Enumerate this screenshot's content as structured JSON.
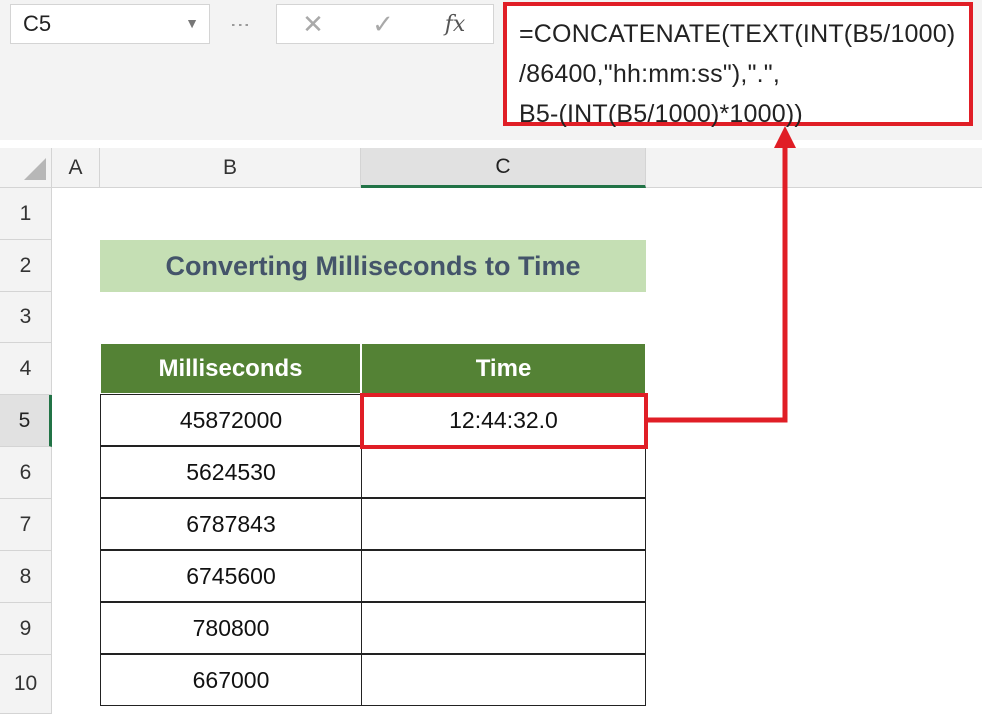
{
  "formula_bar": {
    "name_box": "C5",
    "cancel_icon": "x-icon",
    "enter_icon": "check-icon",
    "fx_label": "fx",
    "formula_lines": [
      "=CONCATENATE(TEXT(INT(B5/1000)",
      "/86400,\"hh:mm:ss\"),\".\",",
      "B5-(INT(B5/1000)*1000))"
    ]
  },
  "columns": [
    "A",
    "B",
    "C"
  ],
  "rows": [
    "1",
    "2",
    "3",
    "4",
    "5",
    "6",
    "7",
    "8",
    "9",
    "10"
  ],
  "title": "Converting Milliseconds to Time",
  "table": {
    "headers": [
      "Milliseconds",
      "Time"
    ],
    "rows": [
      {
        "milliseconds": "45872000",
        "time": "12:44:32.0"
      },
      {
        "milliseconds": "5624530",
        "time": ""
      },
      {
        "milliseconds": "6787843",
        "time": ""
      },
      {
        "milliseconds": "6745600",
        "time": ""
      },
      {
        "milliseconds": "780800",
        "time": ""
      },
      {
        "milliseconds": "667000",
        "time": ""
      }
    ]
  },
  "colors": {
    "highlight": "#e01e26",
    "header_fill": "#548235",
    "title_fill": "#c5dfb4",
    "title_text": "#44546a"
  }
}
